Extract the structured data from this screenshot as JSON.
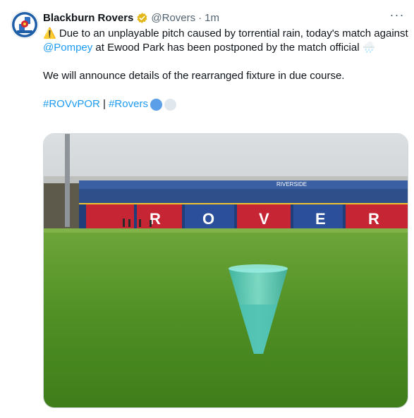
{
  "tweet": {
    "author_name": "Blackburn Rovers",
    "handle": "@Rovers",
    "separator": "·",
    "time": "1m",
    "more_label": "···",
    "warning_emoji": "⚠️",
    "text_line1_a": " Due to an unplayable pitch caused by torrential rain, today's match against ",
    "mention": "@Pompey",
    "text_line1_b": " at Ewood Park has been postponed by the match official ",
    "rain_emoji": "🌧️",
    "text_para2": "We will announce details of the rearranged fixture in due course.",
    "hashtag1": "#ROVvPOR",
    "tag_separator": " | ",
    "hashtag2": "#Rovers",
    "accent_color": "#1d9bf0",
    "dot_colors": [
      "#5b9fe8",
      "#e1e8ed"
    ]
  },
  "media": {
    "stand_sign": "RIVERSIDE",
    "seat_letters": [
      "R",
      "O",
      "V",
      "E",
      "R"
    ]
  },
  "icons": {
    "avatar": "club-crest-icon",
    "verified": "gold-verified-badge-icon"
  }
}
